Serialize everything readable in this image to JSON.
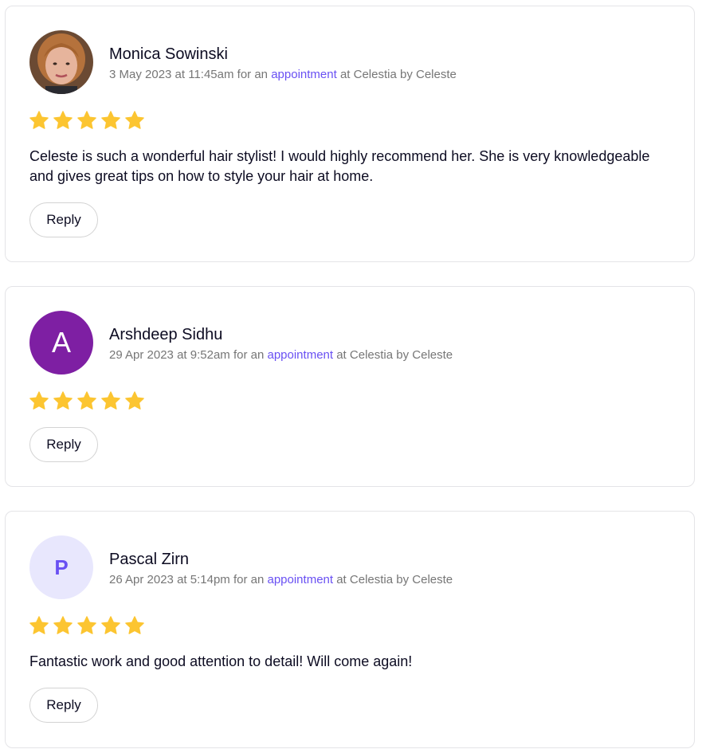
{
  "colors": {
    "accent": "#6950f3",
    "star": "#fcc531",
    "avatar_a_bg": "#7e1fa3",
    "avatar_p_bg": "#e8e7fd"
  },
  "reviews": [
    {
      "name": "Monica Sowinski",
      "date": "3 May 2023 at 11:45am",
      "meta_prefix": "for an",
      "link": "appointment",
      "meta_suffix": "at Celestia by Celeste",
      "rating": 5,
      "avatar": "photo",
      "text": "Celeste is such a wonderful hair stylist! I would highly recommend her. She is very knowledgeable and gives great tips on how to style your hair at home.",
      "reply_label": "Reply"
    },
    {
      "name": "Arshdeep Sidhu",
      "date": "29 Apr 2023 at 9:52am",
      "meta_prefix": "for an",
      "link": "appointment",
      "meta_suffix": "at Celestia by Celeste",
      "rating": 5,
      "avatar": "A",
      "reply_label": "Reply"
    },
    {
      "name": "Pascal Zirn",
      "date": "26 Apr 2023 at 5:14pm",
      "meta_prefix": "for an",
      "link": "appointment",
      "meta_suffix": "at Celestia by Celeste",
      "rating": 5,
      "avatar": "P",
      "text": "Fantastic work and good attention to detail! Will come again!",
      "reply_label": "Reply"
    }
  ]
}
